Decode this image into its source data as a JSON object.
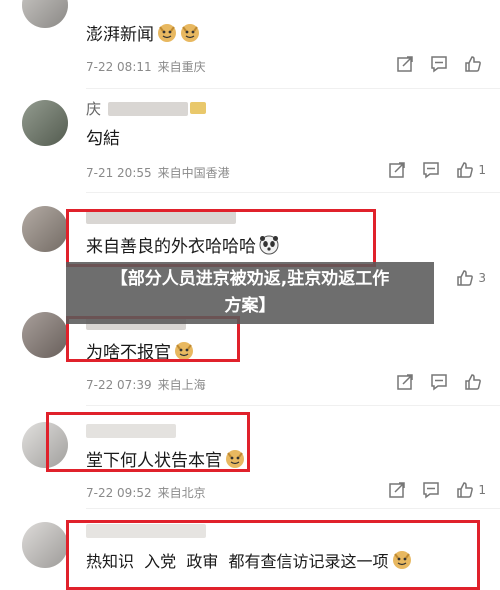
{
  "comments": [
    {
      "username": "",
      "text": "澎湃新闻",
      "emoji": [
        "doge-icon",
        "doge-icon"
      ],
      "date": "7-22 08:11",
      "location": "来自重庆",
      "likes": ""
    },
    {
      "username": "庆",
      "text": "勾結",
      "emoji": [],
      "date": "7-21 20:55",
      "location": "来自中国香港",
      "likes": "1"
    },
    {
      "username": "",
      "text": "来自善良的外衣哈哈哈",
      "emoji": [
        "panda-face-icon"
      ],
      "date": "",
      "location": "",
      "likes": "3"
    },
    {
      "username": "",
      "text": "为啥不报官",
      "emoji": [
        "doge-icon"
      ],
      "date": "7-22 07:39",
      "location": "来自上海",
      "likes": ""
    },
    {
      "username": "",
      "text": "堂下何人状告本官",
      "emoji": [
        "doge-icon"
      ],
      "date": "7-22 09:52",
      "location": "来自北京",
      "likes": "1"
    },
    {
      "username": "",
      "text": "热知识  入党  政审  都有查信访记录这一项",
      "emoji": [
        "doge-icon"
      ],
      "date": "",
      "location": "",
      "likes": ""
    }
  ],
  "banner": {
    "line1": "【部分人员进京被劝返,驻京劝返工作",
    "line2": "方案】"
  },
  "colors": {
    "highlight": "#e0212b",
    "meta": "#8a8a8a",
    "overlay": "#5a5a5a"
  }
}
